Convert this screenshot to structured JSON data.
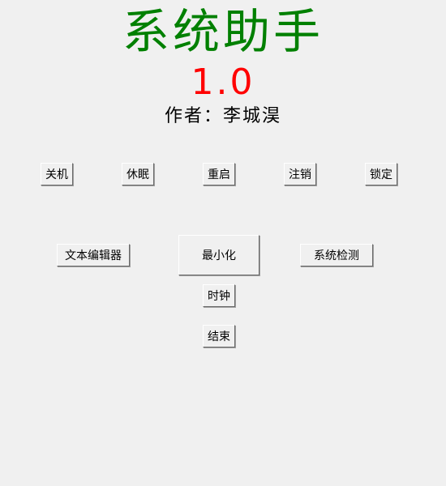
{
  "header": {
    "title": "系统助手",
    "version": "1.0",
    "author": "作者：李城淏",
    "title_color": "#008000",
    "version_color": "#ff0000"
  },
  "power_row": {
    "shutdown": "关机",
    "sleep": "休眠",
    "restart": "重启",
    "logoff": "注销",
    "lock": "锁定"
  },
  "tools": {
    "text_editor": "文本编辑器",
    "minimize": "最小化",
    "system_check": "系统检测",
    "clock": "时钟",
    "exit": "结束"
  },
  "window": {
    "background": "#f0f0f0"
  }
}
